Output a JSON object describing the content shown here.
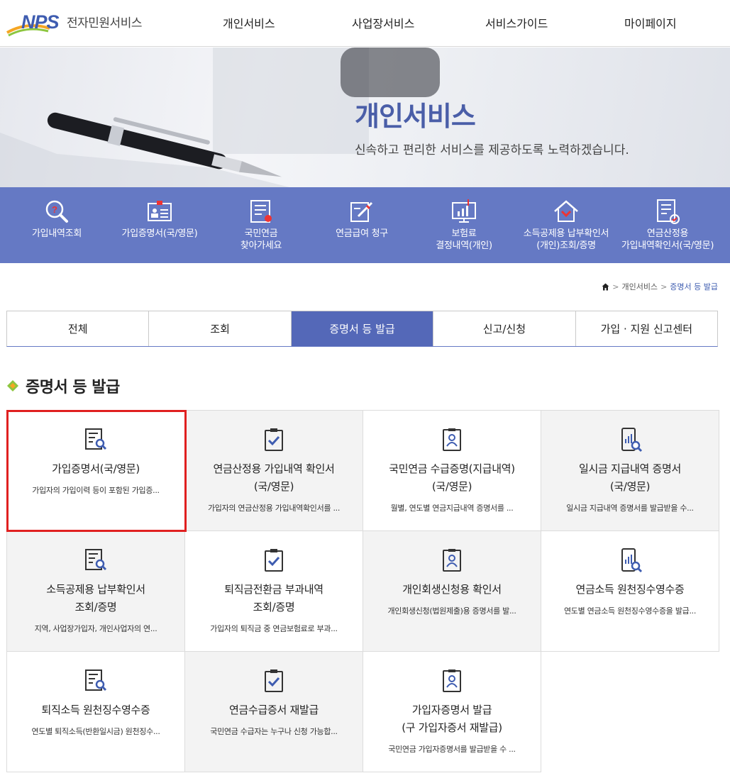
{
  "header": {
    "logo_nps": "NPS",
    "logo_text": "전자민원서비스",
    "nav": [
      "개인서비스",
      "사업장서비스",
      "서비스가이드",
      "마이페이지"
    ]
  },
  "hero": {
    "title": "개인서비스",
    "subtitle": "신속하고 편리한 서비스를 제공하도록 노력하겠습니다."
  },
  "quick_menu": [
    {
      "label": "가입내역조회",
      "icon": "magnifier-question-icon"
    },
    {
      "label": "가입증명서(국/영문)",
      "icon": "id-card-icon"
    },
    {
      "label": "국민연금\n찾아가세요",
      "icon": "document-pen-icon"
    },
    {
      "label": "연금급여 청구",
      "icon": "form-pencil-icon"
    },
    {
      "label": "보험료\n결정내역(개인)",
      "icon": "monitor-chart-icon"
    },
    {
      "label": "소득공제용 납부확인서\n(개인)조회/증명",
      "icon": "house-check-icon"
    },
    {
      "label": "연금산정용\n가입내역확인서(국/영문)",
      "icon": "document-check-icon"
    }
  ],
  "breadcrumb": {
    "home_icon": "home-icon",
    "level1": "개인서비스",
    "current": "증명서 등 발급",
    "separator": ">"
  },
  "tabs": [
    {
      "label": "전체",
      "active": false
    },
    {
      "label": "조회",
      "active": false
    },
    {
      "label": "증명서 등 발급",
      "active": true
    },
    {
      "label": "신고/신청",
      "active": false
    },
    {
      "label": "가입 · 지원 신고센터",
      "active": false
    }
  ],
  "section_title": "증명서 등 발급",
  "cards": [
    {
      "title": "가입증명서(국/영문)",
      "desc": "가입자의 가입이력 등이 포함된 가입증...",
      "icon": "document-search-icon",
      "bg": "white",
      "lines": 1
    },
    {
      "title": "연금산정용 가입내역 확인서\n(국/영문)",
      "desc": "가입자의 연금산정용 가입내역확인서를 ...",
      "icon": "clipboard-check-icon",
      "bg": "gray",
      "lines": 2
    },
    {
      "title": "국민연금 수급증명(지급내역)\n(국/영문)",
      "desc": "월별, 연도별 연금지급내역 증명서를 ...",
      "icon": "clipboard-person-icon",
      "bg": "white",
      "lines": 2
    },
    {
      "title": "일시금 지급내역 증명서\n(국/영문)",
      "desc": "일시금 지급내역 증명서를 발급받을 수...",
      "icon": "phone-chart-search-icon",
      "bg": "gray",
      "lines": 2
    },
    {
      "title": "소득공제용 납부확인서\n조회/증명",
      "desc": "지역, 사업장가입자, 개인사업자의 연...",
      "icon": "document-search-icon",
      "bg": "gray",
      "lines": 2
    },
    {
      "title": "퇴직금전환금 부과내역\n조회/증명",
      "desc": "가입자의 퇴직금 중 연금보험료로 부과...",
      "icon": "clipboard-check-icon",
      "bg": "white",
      "lines": 2
    },
    {
      "title": "개인회생신청용 확인서",
      "desc": "개인회생신청(법원제출)용 증명서를 발...",
      "icon": "clipboard-person-icon",
      "bg": "gray",
      "lines": 1
    },
    {
      "title": "연금소득 원천징수영수증",
      "desc": "연도별 연금소득 원천징수영수증을 발급...",
      "icon": "phone-chart-search-icon",
      "bg": "white",
      "lines": 1
    },
    {
      "title": "퇴직소득 원천징수영수증",
      "desc": "연도별 퇴직소득(반환일시금) 원천징수...",
      "icon": "document-search-icon",
      "bg": "white",
      "lines": 1
    },
    {
      "title": "연금수급증서 재발급",
      "desc": "국민연금 수급자는 누구나 신청 가능합...",
      "icon": "clipboard-check-icon",
      "bg": "gray",
      "lines": 1
    },
    {
      "title": "가입자증명서 발급\n(구 가입자증서 재발급)",
      "desc": "국민연금 가입자증명서를 발급받을 수 ...",
      "icon": "clipboard-person-icon",
      "bg": "white",
      "lines": 2
    }
  ],
  "colors": {
    "brand_blue": "#3e5cb0",
    "quick_bg": "#6579c4",
    "tab_active": "#5468b8",
    "highlight": "#e02020"
  }
}
